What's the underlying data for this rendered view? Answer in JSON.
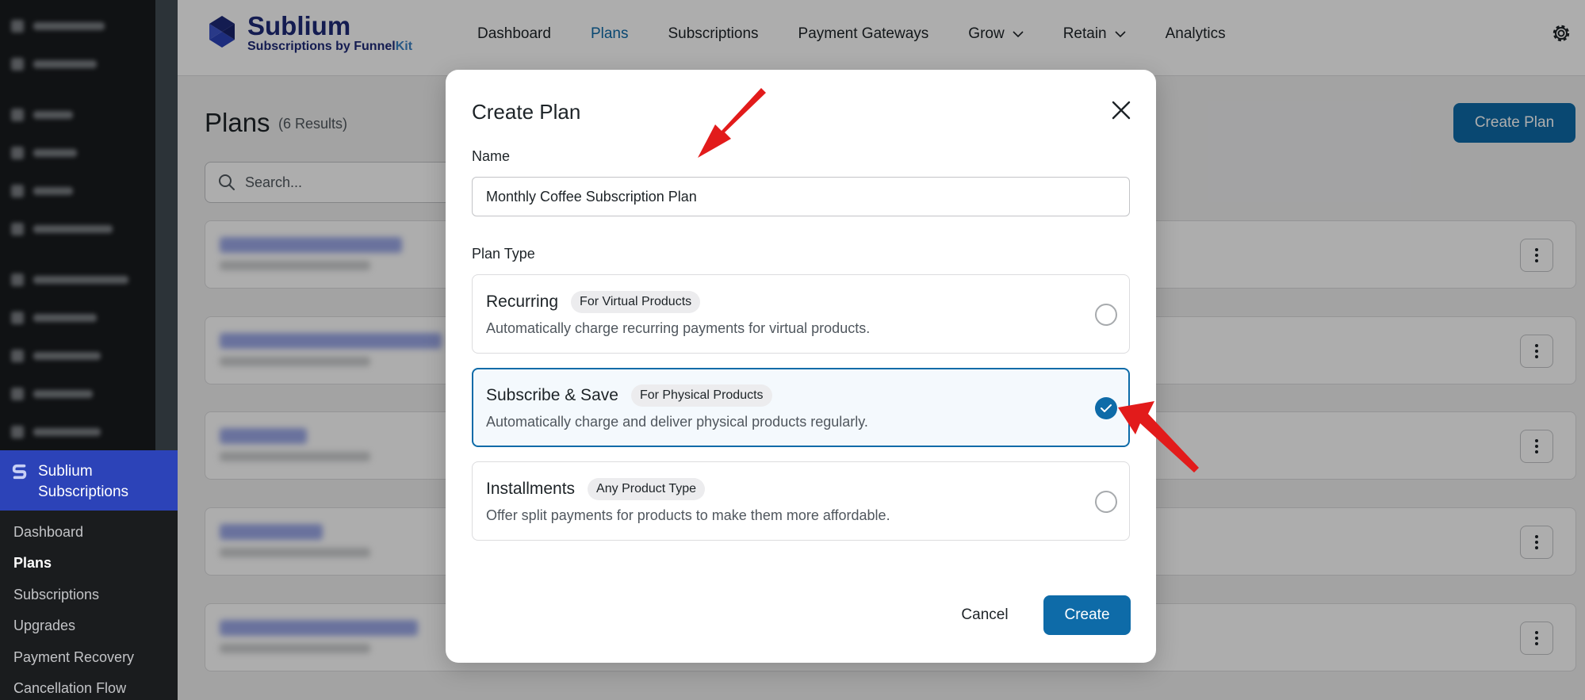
{
  "colors": {
    "accent": "#0e6ba8",
    "brand": "#1e2a78",
    "annotation_arrow": "#e21b1b",
    "sidebar_active": "#2c43b8"
  },
  "sidebar": {
    "active_item": {
      "label_line1": "Sublium",
      "label_line2": "Subscriptions",
      "icon": "sublium-logo-icon"
    },
    "submenu": [
      "Dashboard",
      "Plans",
      "Subscriptions",
      "Upgrades",
      "Payment Recovery",
      "Cancellation Flow"
    ],
    "submenu_active": "Plans"
  },
  "header": {
    "brand_name": "Sublium",
    "brand_tagline_prefix": "Subscriptions by Funnel",
    "brand_tagline_suffix": "Kit",
    "nav": [
      {
        "label": "Dashboard"
      },
      {
        "label": "Plans"
      },
      {
        "label": "Subscriptions"
      },
      {
        "label": "Payment Gateways"
      },
      {
        "label": "Grow"
      },
      {
        "label": "Retain"
      },
      {
        "label": "Analytics"
      }
    ],
    "nav_active": "Plans",
    "settings_icon": "gear-icon"
  },
  "page": {
    "title": "Plans",
    "results": "(6 Results)",
    "create_button": "Create Plan",
    "search_placeholder": "Search..."
  },
  "modal": {
    "title": "Create Plan",
    "name_label": "Name",
    "name_value": "Monthly Coffee Subscription Plan",
    "plan_type_label": "Plan Type",
    "options": [
      {
        "title": "Recurring",
        "badge": "For Virtual Products",
        "description": "Automatically charge recurring payments for virtual products.",
        "selected": false
      },
      {
        "title": "Subscribe & Save",
        "badge": "For Physical Products",
        "description": "Automatically charge and deliver physical products regularly.",
        "selected": true
      },
      {
        "title": "Installments",
        "badge": "Any Product Type",
        "description": "Offer split payments for products to make them more affordable.",
        "selected": false
      }
    ],
    "cancel_label": "Cancel",
    "create_label": "Create"
  }
}
